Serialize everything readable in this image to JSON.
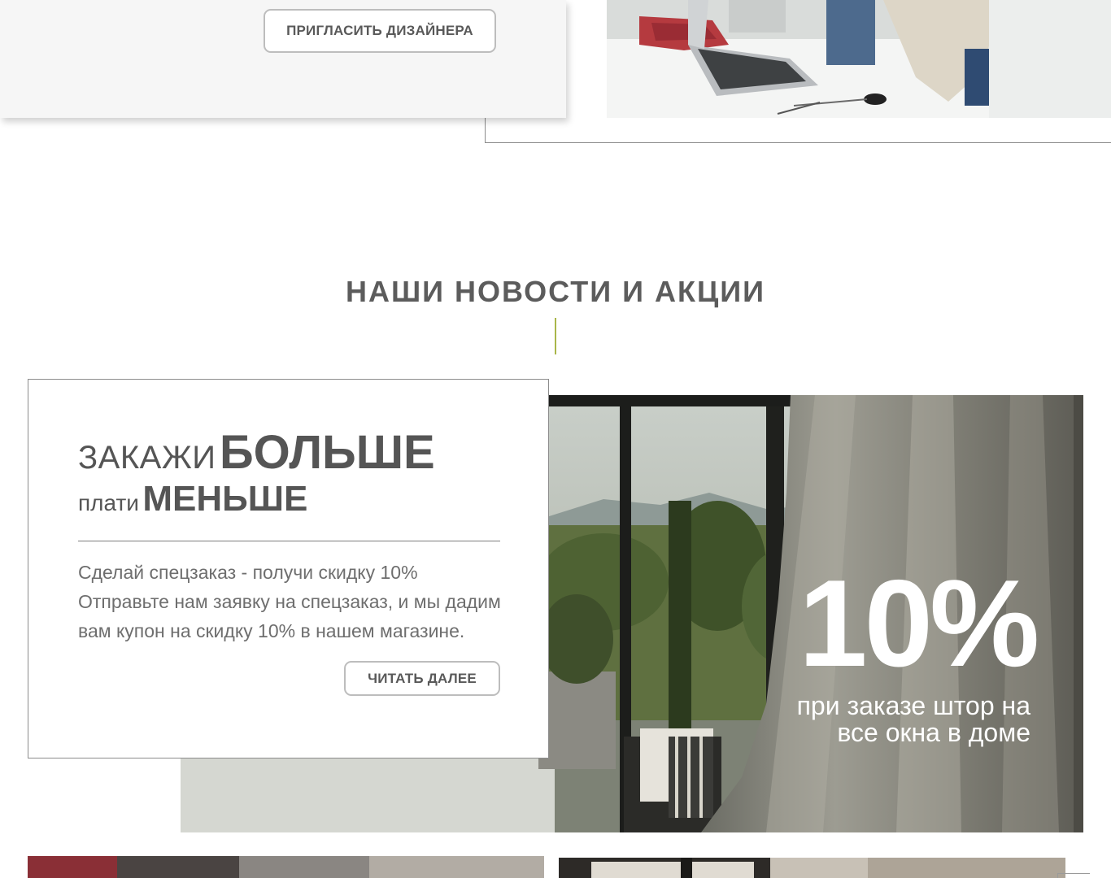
{
  "top_card": {
    "invite_button": "ПРИГЛАСИТЬ ДИЗАЙНЕРА"
  },
  "news_section": {
    "title": "НАШИ НОВОСТИ И АКЦИИ"
  },
  "promo": {
    "headline_light": "ЗАКАЖИ",
    "headline_bold": "БОЛЬШЕ",
    "subheadline_light": "плати",
    "subheadline_bold": "МЕНЬШЕ",
    "description": "Сделай спецзаказ - получи скидку 10% Отправьте нам заявку на спецзаказ, и мы дадим вам купон на скидку 10% в нашем магазине.",
    "read_more_button": "ЧИТАТЬ ДАЛЕЕ",
    "image_big_text": "10%",
    "image_sub_text": "при заказе штор на все окна в доме"
  },
  "colors": {
    "accent_divider": "#a9b64a",
    "heading_text": "#5c5c5c",
    "body_text": "#6e6e6e",
    "card_background": "#f6f6f6"
  }
}
